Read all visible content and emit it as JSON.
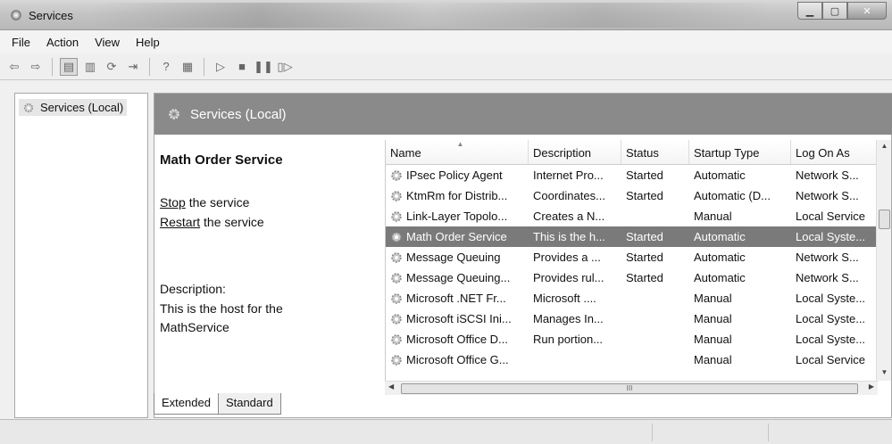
{
  "window": {
    "title": "Services"
  },
  "menu": [
    "File",
    "Action",
    "View",
    "Help"
  ],
  "toolbar": {
    "buttons": [
      {
        "name": "back-icon",
        "glyph": "⇦"
      },
      {
        "name": "forward-icon",
        "glyph": "⇨"
      },
      {
        "name": "console-tree-icon",
        "glyph": "▤"
      },
      {
        "name": "properties-icon",
        "glyph": "▥"
      },
      {
        "name": "refresh-icon",
        "glyph": "⟳"
      },
      {
        "name": "export-list-icon",
        "glyph": "⇥"
      },
      {
        "name": "help-icon",
        "glyph": "?"
      },
      {
        "name": "view-icon",
        "glyph": "▦"
      },
      {
        "name": "start-icon",
        "glyph": "▷"
      },
      {
        "name": "stop-icon",
        "glyph": "■"
      },
      {
        "name": "pause-icon",
        "glyph": "❚❚"
      },
      {
        "name": "resume-icon",
        "glyph": "▯▷"
      }
    ]
  },
  "tree": {
    "item": "Services (Local)"
  },
  "pane": {
    "header": "Services (Local)",
    "service_name": "Math Order Service",
    "stop_link": "Stop",
    "stop_suffix": " the service",
    "restart_link": "Restart",
    "restart_suffix": " the service",
    "description_label": "Description:",
    "description_text": "This is the host for the MathService"
  },
  "table": {
    "columns": [
      "Name",
      "Description",
      "Status",
      "Startup Type",
      "Log On As"
    ],
    "rows": [
      {
        "name": "IPsec Policy Agent",
        "description": "Internet Pro...",
        "status": "Started",
        "startup": "Automatic",
        "logon": "Network S..."
      },
      {
        "name": "KtmRm for Distrib...",
        "description": "Coordinates...",
        "status": "Started",
        "startup": "Automatic (D...",
        "logon": "Network S..."
      },
      {
        "name": "Link-Layer Topolo...",
        "description": "Creates a N...",
        "status": "",
        "startup": "Manual",
        "logon": "Local Service"
      },
      {
        "name": "Math Order Service",
        "description": "This is the h...",
        "status": "Started",
        "startup": "Automatic",
        "logon": "Local Syste...",
        "selected": true
      },
      {
        "name": "Message Queuing",
        "description": "Provides a ...",
        "status": "Started",
        "startup": "Automatic",
        "logon": "Network S..."
      },
      {
        "name": "Message Queuing...",
        "description": "Provides rul...",
        "status": "Started",
        "startup": "Automatic",
        "logon": "Network S..."
      },
      {
        "name": "Microsoft .NET Fr...",
        "description": "Microsoft ....",
        "status": "",
        "startup": "Manual",
        "logon": "Local Syste..."
      },
      {
        "name": "Microsoft iSCSI Ini...",
        "description": "Manages In...",
        "status": "",
        "startup": "Manual",
        "logon": "Local Syste..."
      },
      {
        "name": "Microsoft Office D...",
        "description": "Run portion...",
        "status": "",
        "startup": "Manual",
        "logon": "Local Syste..."
      },
      {
        "name": "Microsoft Office G...",
        "description": "",
        "status": "",
        "startup": "Manual",
        "logon": "Local Service"
      }
    ]
  },
  "tabs": [
    "Extended",
    "Standard"
  ],
  "scroll": {
    "h_thumb_grip": "III"
  }
}
